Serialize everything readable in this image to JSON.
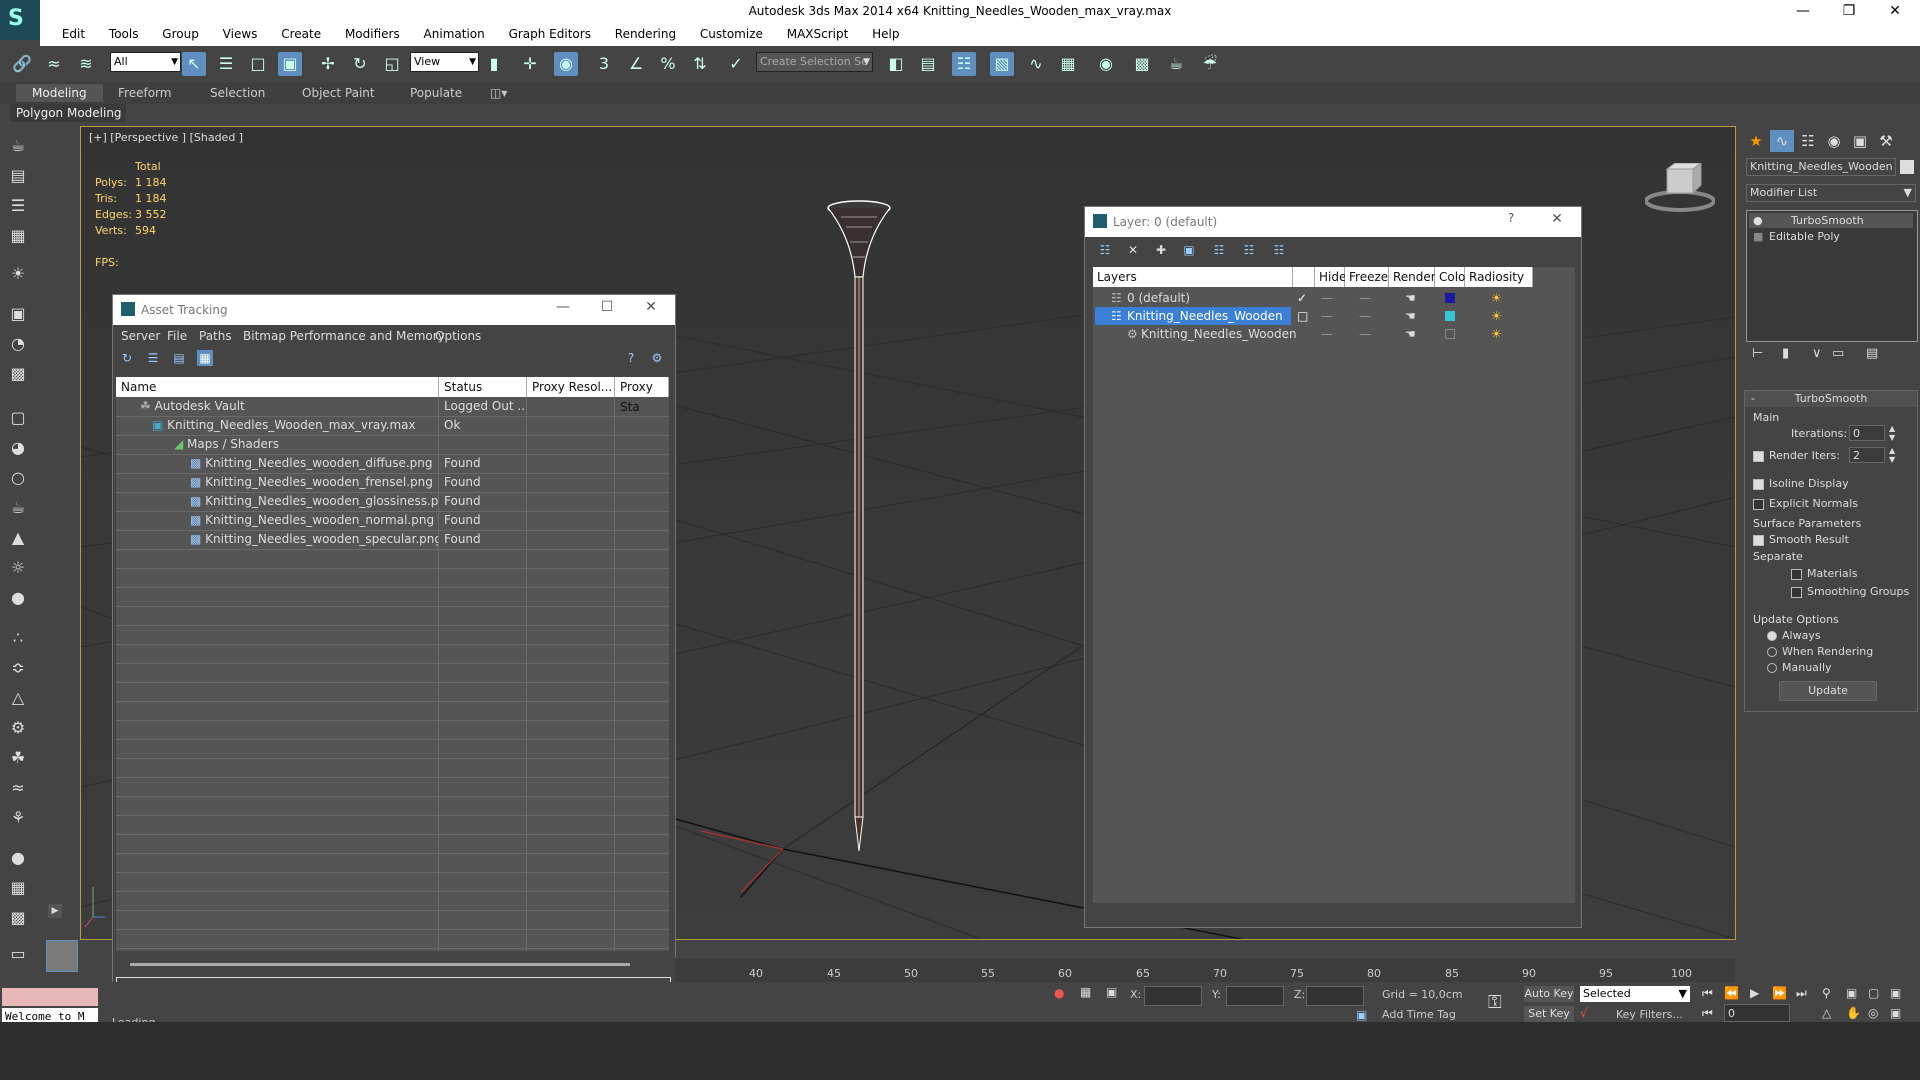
{
  "app": {
    "window_title": "Autodesk 3ds Max  2014 x64     Knitting_Needles_Wooden_max_vray.max"
  },
  "menu": [
    "Edit",
    "Tools",
    "Group",
    "Views",
    "Create",
    "Modifiers",
    "Animation",
    "Graph Editors",
    "Rendering",
    "Customize",
    "MAXScript",
    "Help"
  ],
  "toolbar": {
    "selection_filter": "All",
    "reference_coord": "View",
    "named_selection_placeholder": "Create Selection Se"
  },
  "ribbon": {
    "tabs": [
      "Modeling",
      "Freeform",
      "Selection",
      "Object Paint",
      "Populate"
    ],
    "active_tab": "Modeling",
    "panel_label": "Polygon Modeling"
  },
  "viewport": {
    "label": "[+] [Perspective ] [Shaded ]",
    "stats": {
      "header": "Total",
      "rows": [
        {
          "label": "Polys:",
          "value": "1 184"
        },
        {
          "label": "Tris:",
          "value": "1 184"
        },
        {
          "label": "Edges:",
          "value": "3 552"
        },
        {
          "label": "Verts:",
          "value": "594"
        }
      ],
      "fps_label": "FPS:"
    }
  },
  "asset_tracking": {
    "title": "Asset Tracking",
    "menu": [
      "Server",
      "File",
      "Paths",
      "Bitmap Performance and Memory",
      "Options"
    ],
    "columns": [
      "Name",
      "Status",
      "Proxy Resol...",
      "Proxy Sta"
    ],
    "rows": [
      {
        "name": "Autodesk Vault",
        "status": "Logged Out ..."
      },
      {
        "name": "Knitting_Needles_Wooden_max_vray.max",
        "status": "Ok"
      },
      {
        "name": "Maps / Shaders",
        "status": ""
      },
      {
        "name": "Knitting_Needles_wooden_diffuse.png",
        "status": "Found"
      },
      {
        "name": "Knitting_Needles_wooden_frensel.png",
        "status": "Found"
      },
      {
        "name": "Knitting_Needles_wooden_glossiness.png",
        "status": "Found"
      },
      {
        "name": "Knitting_Needles_wooden_normal.png",
        "status": "Found"
      },
      {
        "name": "Knitting_Needles_wooden_specular.png",
        "status": "Found"
      }
    ]
  },
  "layer_window": {
    "title": "Layer: 0 (default)",
    "help": "?",
    "columns": [
      "Layers",
      "Hide",
      "Freeze",
      "Render",
      "Color",
      "Radiosity"
    ],
    "rows": [
      {
        "name": "0 (default)",
        "color": "#1a1aa0"
      },
      {
        "name": "Knitting_Needles_Wooden",
        "color": "#36c6d6"
      },
      {
        "name": "Knitting_Needles_Wooden",
        "color": "#555555"
      }
    ]
  },
  "command_panel": {
    "object_name": "Knitting_Needles_Wooden",
    "modifier_list": "Modifier List",
    "stack": [
      "TurboSmooth",
      "Editable Poly"
    ],
    "rollout": {
      "title": "TurboSmooth",
      "main_label": "Main",
      "iterations_label": "Iterations:",
      "iterations_value": "0",
      "render_iters_label": "Render Iters:",
      "render_iters_value": "2",
      "isoline_label": "Isoline Display",
      "explicit_normals_label": "Explicit Normals",
      "surface_params_label": "Surface Parameters",
      "smooth_result_label": "Smooth Result",
      "separate_label": "Separate",
      "materials_label": "Materials",
      "smoothing_groups_label": "Smoothing Groups",
      "update_options_label": "Update Options",
      "always_label": "Always",
      "when_rendering_label": "When Rendering",
      "manually_label": "Manually",
      "update_button": "Update"
    }
  },
  "timeline": {
    "ticks": [
      "40",
      "45",
      "50",
      "55",
      "60",
      "65",
      "70",
      "75",
      "80",
      "85",
      "90",
      "95",
      "100"
    ]
  },
  "statusbar": {
    "x_label": "X:",
    "y_label": "Y:",
    "z_label": "Z:",
    "grid": "Grid = 10,0cm",
    "add_time_tag": "Add Time Tag",
    "auto_key": "Auto Key",
    "set_key": "Set Key",
    "key_mode": "Selected",
    "key_filters": "Key Filters...",
    "frame": "0",
    "welcome": "Welcome to M",
    "loading": "Loading..."
  }
}
